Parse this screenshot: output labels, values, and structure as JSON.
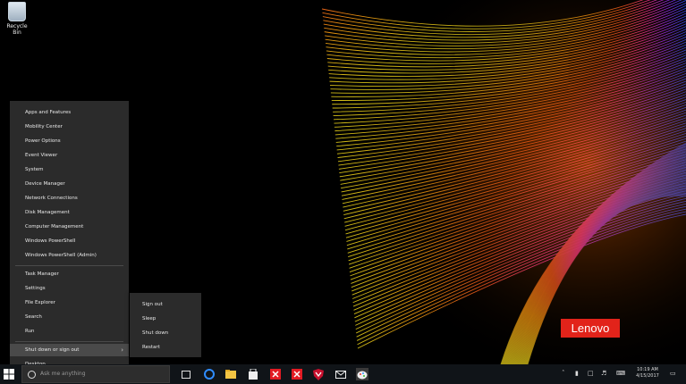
{
  "desktop": {
    "recycle_bin_label": "Recycle Bin"
  },
  "winx_menu": {
    "items_top": [
      "Apps and Features",
      "Mobility Center",
      "Power Options",
      "Event Viewer",
      "System",
      "Device Manager",
      "Network Connections",
      "Disk Management",
      "Computer Management",
      "Windows PowerShell",
      "Windows PowerShell (Admin)"
    ],
    "items_mid": [
      "Task Manager",
      "Settings",
      "File Explorer",
      "Search",
      "Run"
    ],
    "shutdown_label": "Shut down or sign out",
    "desktop_label": "Desktop"
  },
  "submenu": {
    "items": [
      "Sign out",
      "Sleep",
      "Shut down",
      "Restart"
    ]
  },
  "brand": {
    "logo_text": "Lenovo",
    "logo_color": "#e2231a"
  },
  "taskbar": {
    "search_placeholder": "Ask me anything",
    "clock_time": "10:19 AM",
    "clock_date": "4/15/2017"
  },
  "colors": {
    "menu_bg": "#2b2b2b",
    "menu_highlight": "#4a4a4a",
    "taskbar_bg": "#101418"
  }
}
